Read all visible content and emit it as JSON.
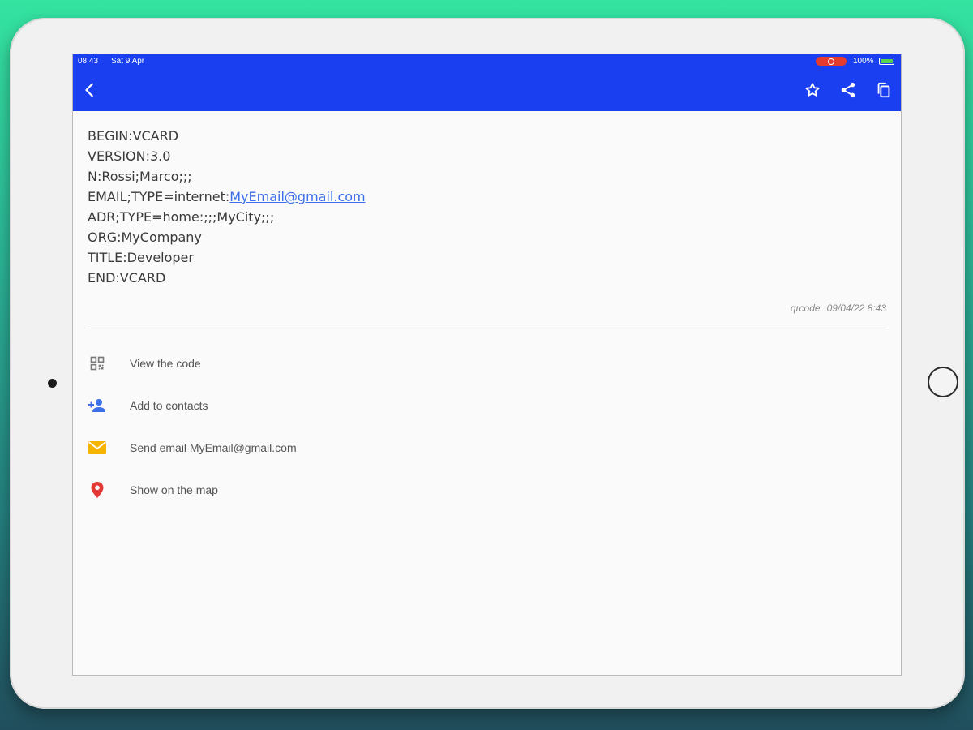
{
  "status_bar": {
    "time": "08:43",
    "date": "Sat 9 Apr",
    "battery": "100%"
  },
  "app_bar": {
    "back_icon": "back-arrow-icon",
    "actions": [
      "star-icon",
      "share-icon",
      "copy-icon"
    ],
    "color": "#1a3ff0"
  },
  "vcard": {
    "lines": [
      "BEGIN:VCARD",
      "VERSION:3.0",
      "N:Rossi;Marco;;;",
      "EMAIL;TYPE=internet:",
      "ADR;TYPE=home:;;;MyCity;;;",
      "ORG:MyCompany",
      "TITLE:Developer",
      "END:VCARD"
    ],
    "email_link": "MyEmail@gmail.com"
  },
  "meta": {
    "type": "qrcode",
    "timestamp": "09/04/22 8:43"
  },
  "actions": [
    {
      "label": "View the code",
      "icon": "qr-code-icon"
    },
    {
      "label": "Add to contacts",
      "icon": "add-person-icon"
    },
    {
      "label": "Send email MyEmail@gmail.com",
      "icon": "email-icon"
    },
    {
      "label": "Show on the map",
      "icon": "map-pin-icon"
    }
  ],
  "colors": {
    "link": "#3d6fe8",
    "email_icon": "#f4b400",
    "pin_icon": "#e53935",
    "contact_icon": "#3d6fe8"
  }
}
